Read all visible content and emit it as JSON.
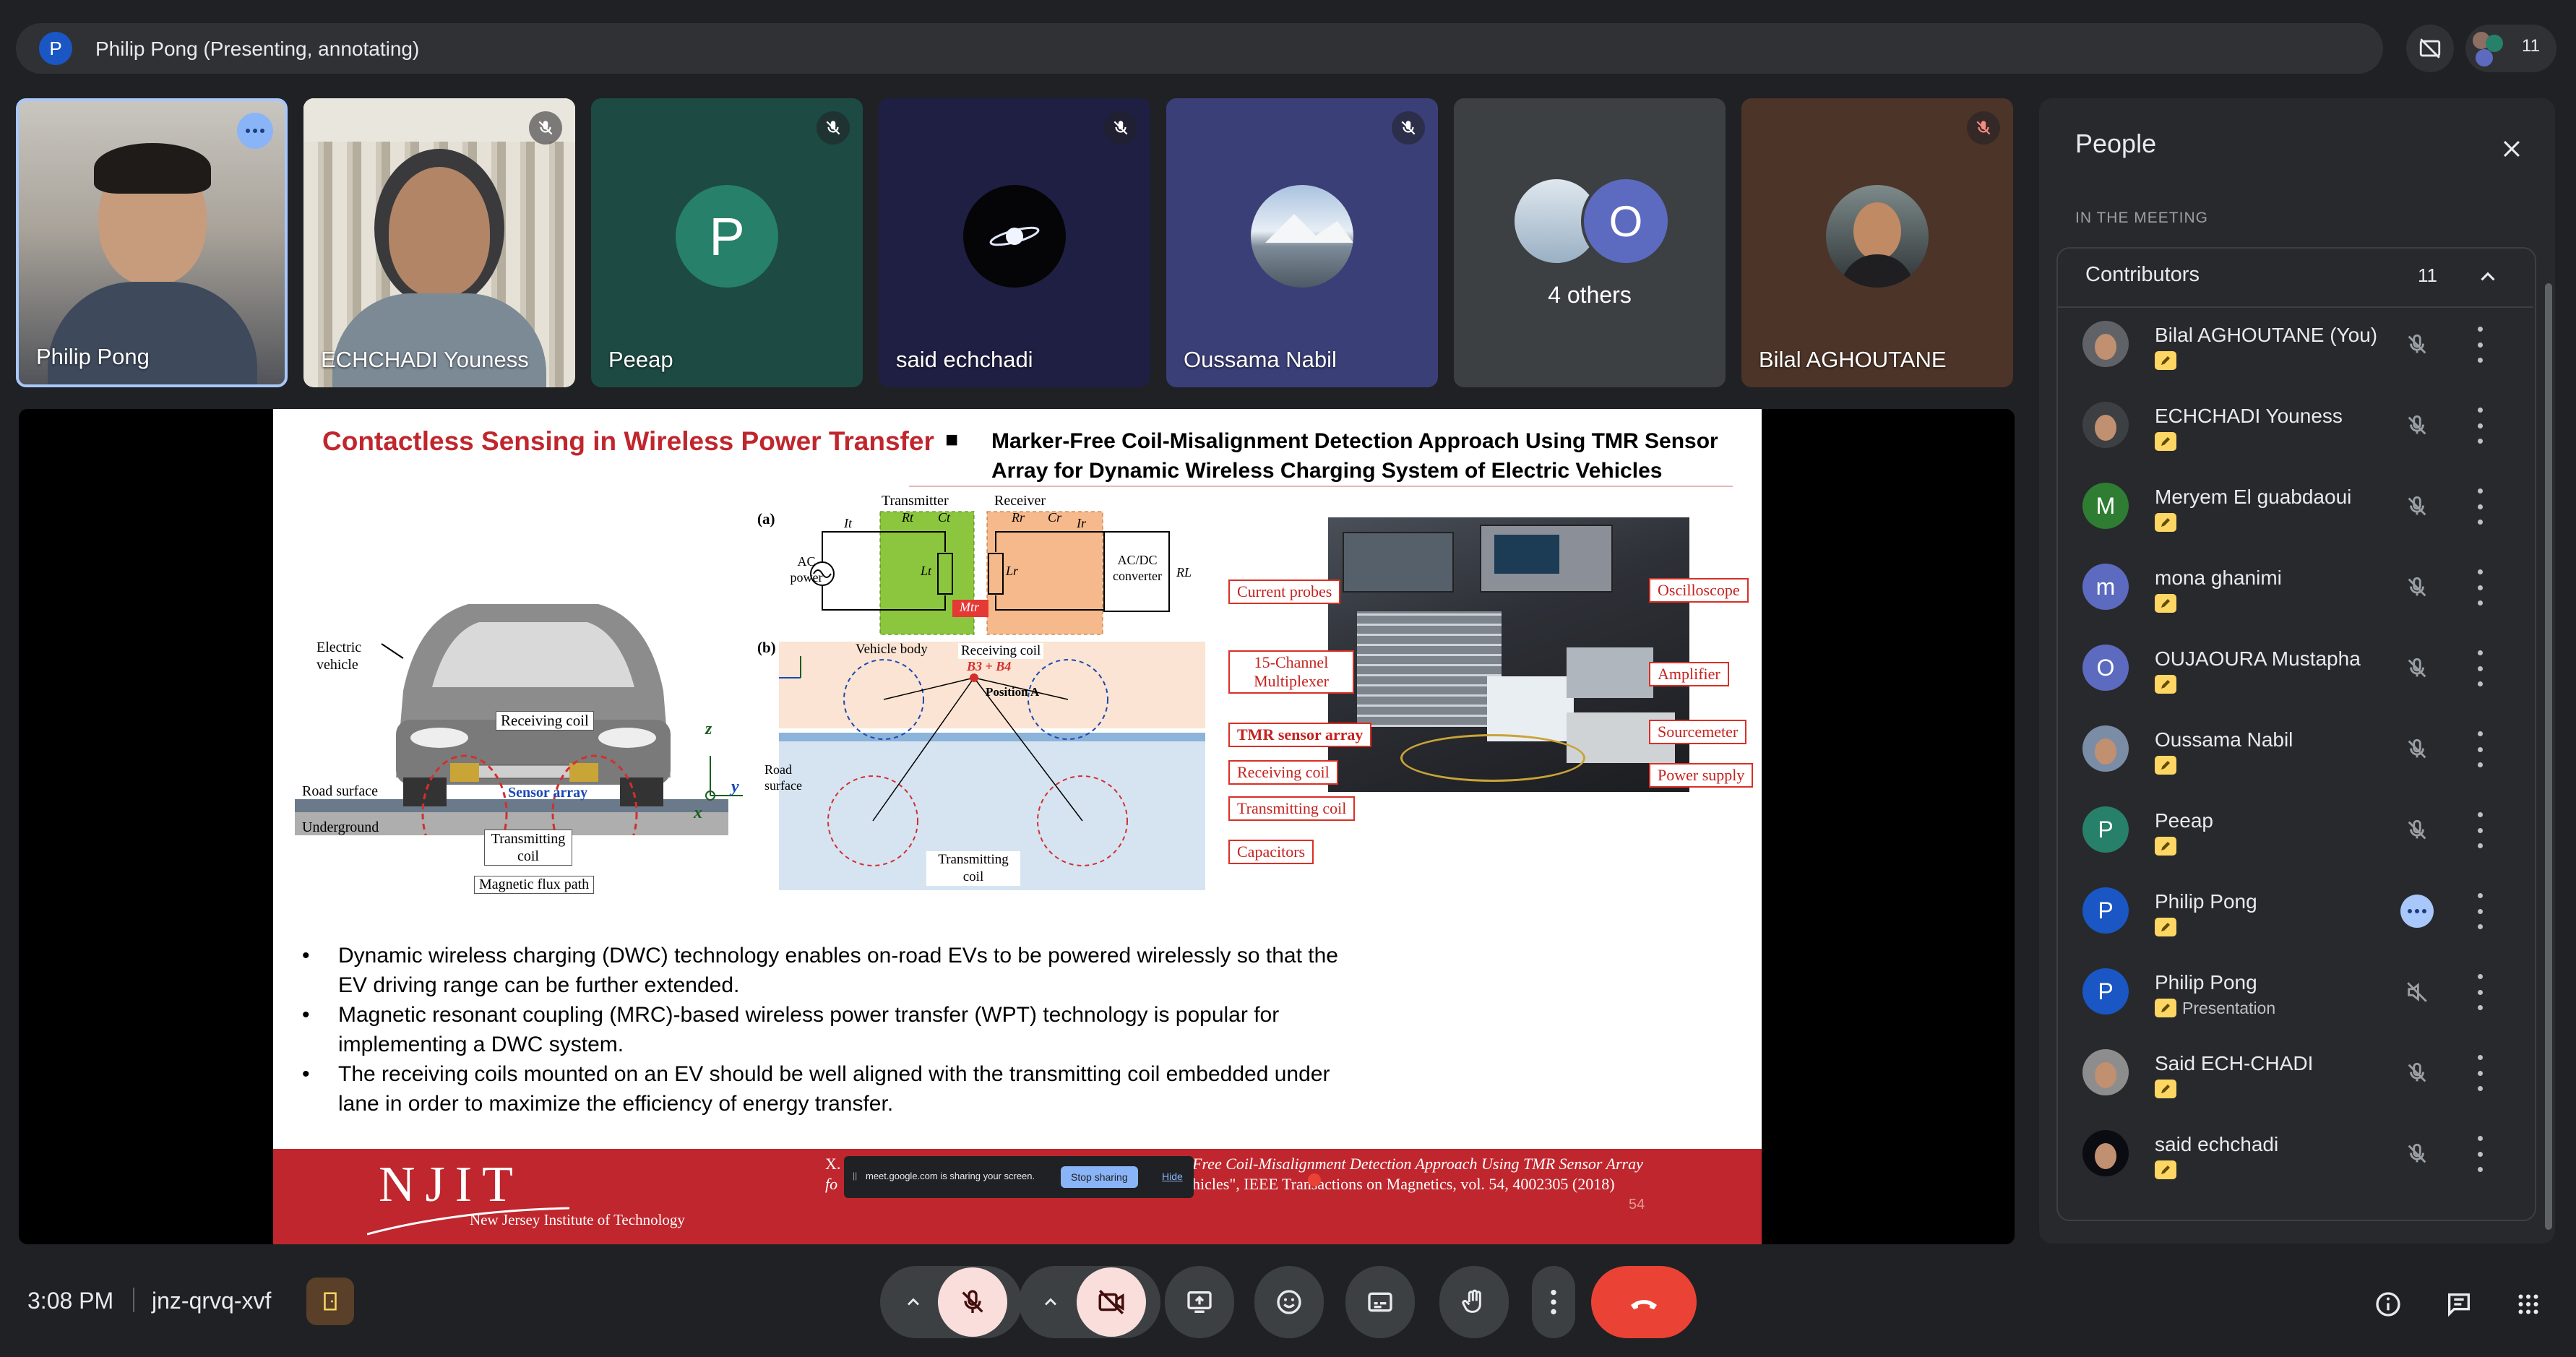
{
  "presenter_bar": {
    "avatar_letter": "P",
    "label": "Philip Pong (Presenting, annotating)",
    "participant_count": "11"
  },
  "tiles": [
    {
      "name": "Philip Pong"
    },
    {
      "name": "ECHCHADI Youness"
    },
    {
      "name": "Peeap",
      "letter": "P"
    },
    {
      "name": "said echchadi"
    },
    {
      "name": "Oussama Nabil"
    },
    {
      "name": "4 others",
      "letter": "O"
    },
    {
      "name": "Bilal AGHOUTANE"
    }
  ],
  "slide": {
    "title": "Contactless Sensing in Wireless Power Transfer",
    "paper_title": "Marker-Free Coil-Misalignment Detection Approach Using TMR Sensor Array for Dynamic Wireless Charging System of Electric Vehicles",
    "car_diagram": {
      "electric_vehicle": "Electric vehicle",
      "receiving_coil": "Receiving coil",
      "sensor_array": "Sensor array",
      "road_surface": "Road surface",
      "underground": "Underground",
      "transmitting_coil": "Transmitting coil",
      "flux_path": "Magnetic flux path",
      "z": "z",
      "y": "y",
      "x": "x"
    },
    "circuit": {
      "a": "(a)",
      "b": "(b)",
      "transmitter": "Transmitter",
      "receiver": "Receiver",
      "ac_power": "AC power",
      "converter": "AC/DC converter",
      "rt": "Rt",
      "ct": "Ct",
      "rr": "Rr",
      "cr": "Cr",
      "it": "It",
      "ir": "Ir",
      "lt": "Lt",
      "lr": "Lr",
      "mtr": "Mtr",
      "rl": "RL",
      "vehicle_body": "Vehicle body",
      "receiving_coil": "Receiving coil",
      "road_surface": "Road surface",
      "transmitting_coil": "Transmitting coil",
      "position_a": "Position A",
      "b3b4": "B3 + B4"
    },
    "lab_labels": {
      "current_probes": "Current probes",
      "multiplexer": "15-Channel Multiplexer",
      "tmr": "TMR sensor array",
      "receiving_coil": "Receiving coil",
      "transmitting_coil": "Transmitting coil",
      "capacitors": "Capacitors",
      "oscilloscope": "Oscilloscope",
      "amplifier": "Amplifier",
      "sourcemeter": "Sourcemeter",
      "power_supply": "Power supply"
    },
    "bullets": [
      "Dynamic wireless charging (DWC) technology enables on-road EVs to be powered wirelessly so that the EV driving range can be further extended.",
      "Magnetic resonant coupling (MRC)-based wireless power transfer (WPT) technology is popular for implementing a DWC system.",
      "The receiving coils mounted on an EV should be well aligned with the transmitting coil embedded under lane in order to maximize the efficiency of energy transfer."
    ],
    "footer": {
      "logo": "NJIT",
      "institute": "New Jersey Institute of Technology",
      "ref_left_1": "X.",
      "ref_left_2": "fo",
      "ref_line1": "Free Coil-Misalignment Detection Approach Using TMR Sensor Array",
      "ref_line2": "hicles\", IEEE Transactions on Magnetics, vol. 54, 4002305 (2018)",
      "page": "54"
    },
    "share_banner": {
      "text": "meet.google.com is sharing your screen.",
      "stop": "Stop sharing",
      "hide": "Hide"
    }
  },
  "people_panel": {
    "title": "People",
    "section": "IN THE MEETING",
    "group": "Contributors",
    "group_count": "11",
    "participants": [
      {
        "name": "Bilal AGHOUTANE (You)",
        "avatar": "photo",
        "color": "#5f6368",
        "letter": ""
      },
      {
        "name": "ECHCHADI Youness",
        "avatar": "photo",
        "color": "#3c4043",
        "letter": ""
      },
      {
        "name": "Meryem El guabdaoui",
        "avatar": "letter",
        "color": "#2e7d32",
        "letter": "M"
      },
      {
        "name": "mona ghanimi",
        "avatar": "letter",
        "color": "#5c6bc0",
        "letter": "m"
      },
      {
        "name": "OUJAOURA Mustapha",
        "avatar": "letter",
        "color": "#5c6bc0",
        "letter": "O"
      },
      {
        "name": "Oussama Nabil",
        "avatar": "photo",
        "color": "#7b8da6",
        "letter": ""
      },
      {
        "name": "Peeap",
        "avatar": "letter",
        "color": "#26806a",
        "letter": "P"
      },
      {
        "name": "Philip Pong",
        "avatar": "letter",
        "color": "#1a56c4",
        "letter": "P"
      },
      {
        "name": "Philip Pong",
        "avatar": "letter",
        "color": "#1a56c4",
        "letter": "P",
        "sub": "Presentation"
      },
      {
        "name": "Said ECH-CHADI",
        "avatar": "photo",
        "color": "#8d8d8d",
        "letter": ""
      },
      {
        "name": "said echchadi",
        "avatar": "photo",
        "color": "#0b0b12",
        "letter": ""
      }
    ]
  },
  "bottom_bar": {
    "time": "3:08 PM",
    "meeting_code": "jnz-qrvq-xvf"
  },
  "colors": {
    "bg": "#202124",
    "surface": "#303134",
    "red": "#ea4335",
    "slide_red": "#c0262d",
    "accent_blue": "#8ab4f8"
  }
}
